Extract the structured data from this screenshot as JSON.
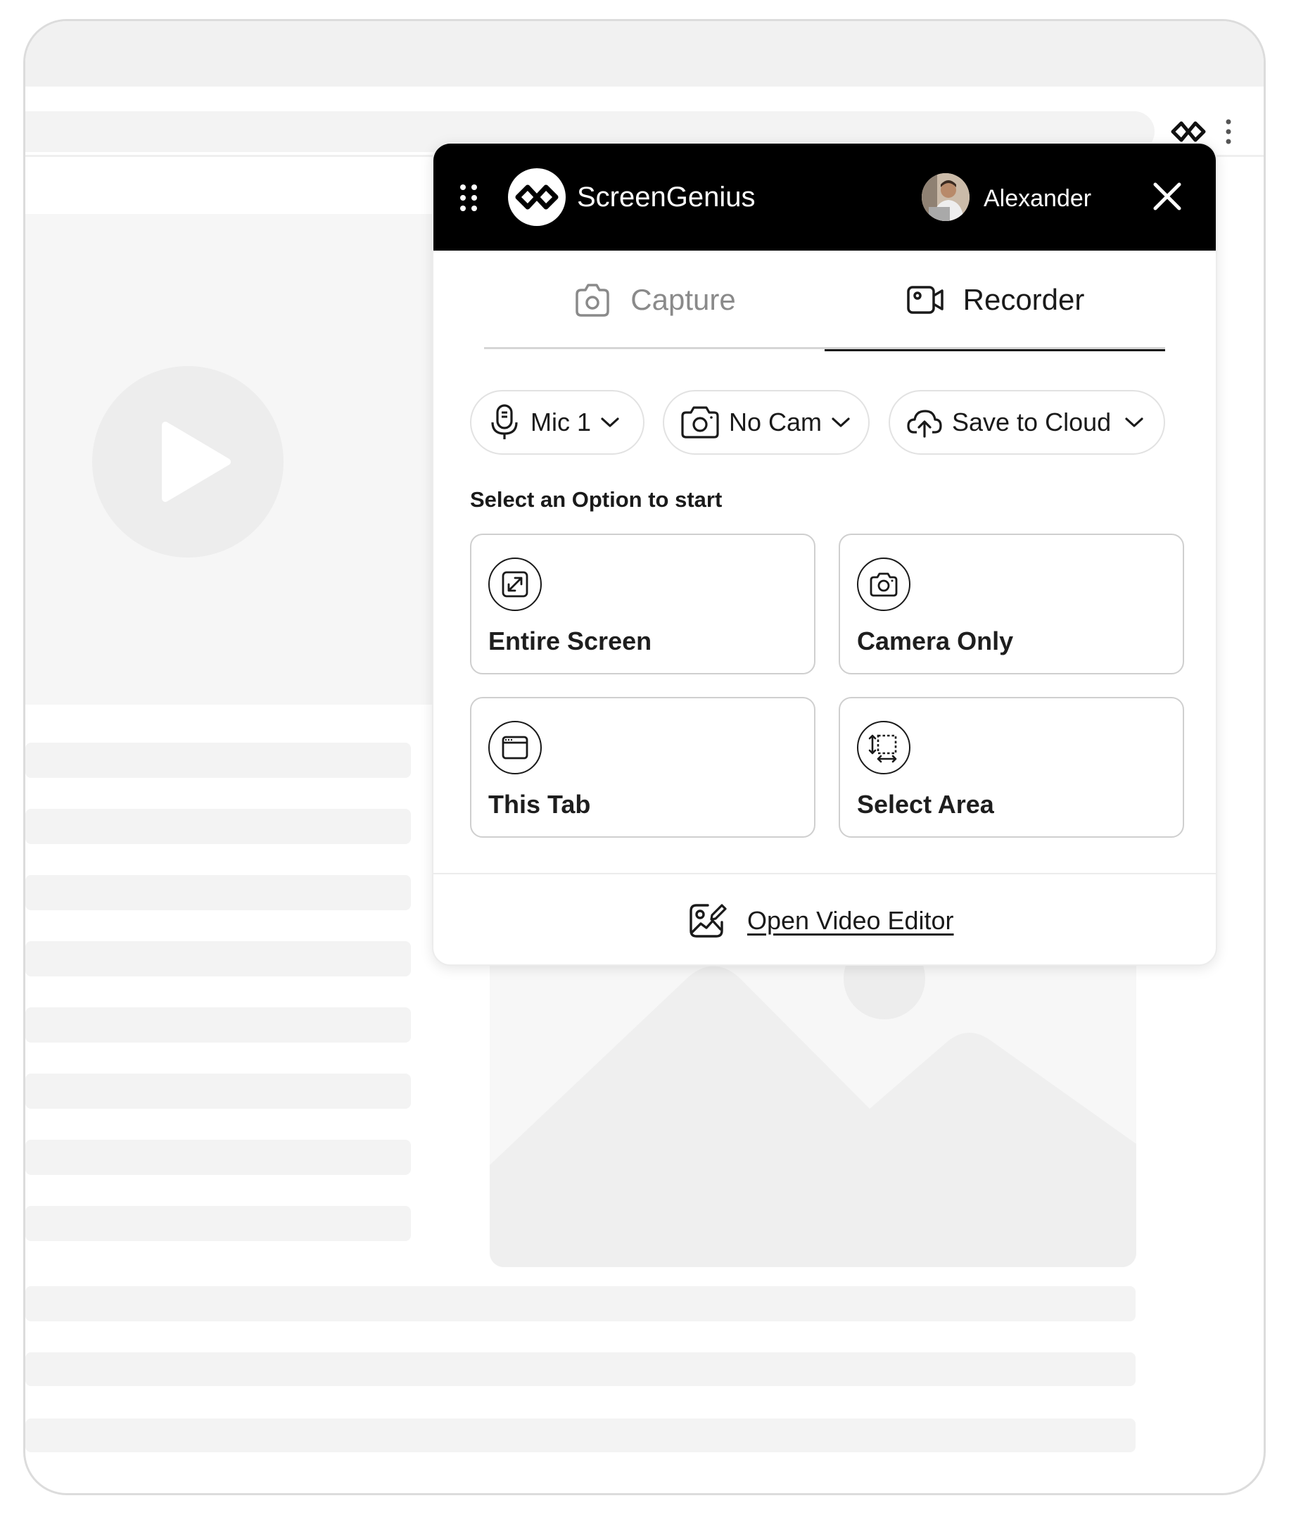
{
  "app": {
    "brand": "ScreenGenius",
    "user_name": "Alexander"
  },
  "tabs": [
    {
      "label": "Capture",
      "icon": "camera-icon",
      "active": false
    },
    {
      "label": "Recorder",
      "icon": "video-camera-icon",
      "active": true
    }
  ],
  "settings": {
    "mic": "Mic 1",
    "camera": "No Cam",
    "save_target": "Save to Cloud"
  },
  "options": {
    "title": "Select an Option to start",
    "items": [
      {
        "label": "Entire Screen",
        "icon": "expand-icon"
      },
      {
        "label": "Camera Only",
        "icon": "camera-icon"
      },
      {
        "label": "This Tab",
        "icon": "browser-tab-icon"
      },
      {
        "label": "Select Area",
        "icon": "select-area-icon"
      }
    ]
  },
  "footer": {
    "editor_link": "Open Video Editor",
    "icon": "image-edit-icon"
  },
  "colors": {
    "header_bg": "#000000",
    "text": "#1a1a1a",
    "muted_tab": "#8a8a8a",
    "border": "#cfcfcf"
  }
}
